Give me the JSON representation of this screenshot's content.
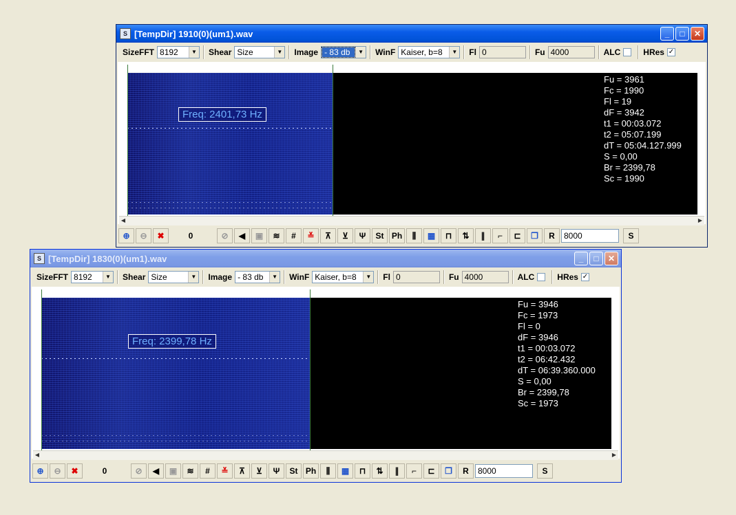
{
  "windows": [
    {
      "title": "[TempDir] 1910(0)(um1).wav",
      "state": "active",
      "icon": "spectrum-app-icon",
      "toolbar": {
        "sizefft_label": "SizeFFT",
        "sizefft_value": "8192",
        "shear_label": "Shear",
        "shear_value": "Size",
        "image_label": "Image",
        "image_value": "- 83 db",
        "winf_label": "WinF",
        "winf_value": "Kaiser, b=8",
        "fl_label": "Fl",
        "fl_value": "0",
        "fu_label": "Fu",
        "fu_value": "4000",
        "alc_label": "ALC",
        "alc_checked": "",
        "hres_label": "HRes",
        "hres_checked": "✓"
      },
      "freq_marker": "Freq: 2401,73 Hz",
      "info": [
        "Fu = 3961",
        "Fc = 1990",
        "Fl = 19",
        "dF = 3942",
        "t1 = 00:03.072",
        "t2 = 05:07.199",
        "dT = 05:04.127.999",
        "S = 0,00",
        "Br = 2399,78",
        "Sc = 1990"
      ],
      "bottom": {
        "counter": "0",
        "ph_label": "Ph",
        "st_label": "St",
        "r_label": "R",
        "rate_value": "8000",
        "s_label": "S"
      }
    },
    {
      "title": "[TempDir] 1830(0)(um1).wav",
      "state": "inactive",
      "icon": "spectrum-app-icon",
      "toolbar": {
        "sizefft_label": "SizeFFT",
        "sizefft_value": "8192",
        "shear_label": "Shear",
        "shear_value": "Size",
        "image_label": "Image",
        "image_value": "- 83 db",
        "winf_label": "WinF",
        "winf_value": "Kaiser, b=8",
        "fl_label": "Fl",
        "fl_value": "0",
        "fu_label": "Fu",
        "fu_value": "4000",
        "alc_label": "ALC",
        "alc_checked": "",
        "hres_label": "HRes",
        "hres_checked": "✓"
      },
      "freq_marker": "Freq: 2399,78 Hz",
      "info": [
        "Fu = 3946",
        "Fc = 1973",
        "Fl = 0",
        "dF = 3946",
        "t1 = 00:03.072",
        "t2 = 06:42.432",
        "dT = 06:39.360.000",
        "S = 0,00",
        "Br = 2399,78",
        "Sc = 1973"
      ],
      "bottom": {
        "counter": "0",
        "ph_label": "Ph",
        "st_label": "St",
        "r_label": "R",
        "rate_value": "8000",
        "s_label": "S"
      }
    }
  ],
  "colors": {
    "active_title": "#0a5ce8",
    "inactive_title": "#7f9fe8",
    "spectrogram": "#1a2a8e",
    "plot_background": "#000000",
    "freq_marker_text": "#6fb0ff"
  }
}
